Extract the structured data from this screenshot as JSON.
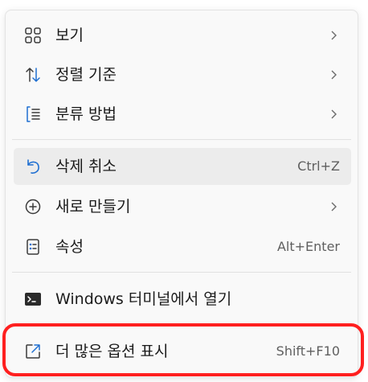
{
  "menu": {
    "items": [
      {
        "label": "보기",
        "icon": "grid-view-icon",
        "has_submenu": true
      },
      {
        "label": "정렬 기준",
        "icon": "sort-icon",
        "has_submenu": true
      },
      {
        "label": "분류 방법",
        "icon": "group-by-icon",
        "has_submenu": true
      },
      {
        "label": "삭제 취소",
        "icon": "undo-icon",
        "shortcut": "Ctrl+Z"
      },
      {
        "label": "새로 만들기",
        "icon": "add-new-icon",
        "has_submenu": true
      },
      {
        "label": "속성",
        "icon": "properties-icon",
        "shortcut": "Alt+Enter"
      },
      {
        "label": "Windows 터미널에서 열기",
        "icon": "terminal-icon"
      },
      {
        "label": "더 많은 옵션 표시",
        "icon": "show-more-options-icon",
        "shortcut": "Shift+F10"
      }
    ]
  },
  "colors": {
    "highlight_frame": "#ff1f1f",
    "icon_accent": "#1f6fd1",
    "hover_bg": "#ececec"
  }
}
